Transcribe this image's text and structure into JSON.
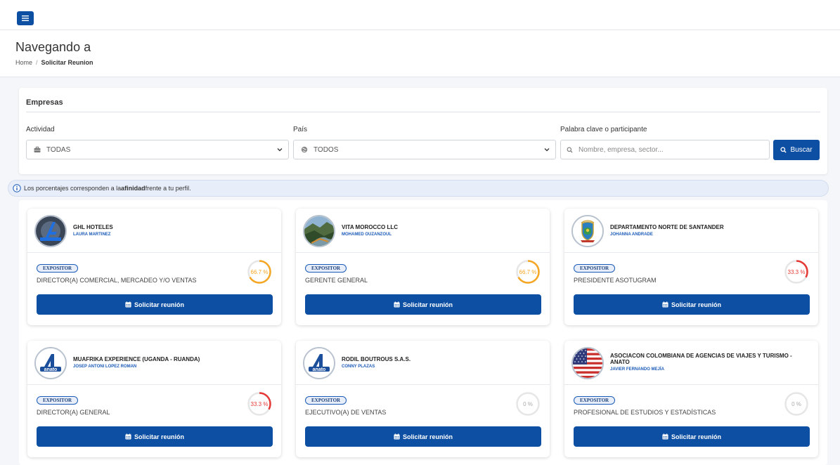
{
  "page": {
    "title": "Navegando a",
    "breadcrumb": {
      "home": "Home",
      "separator": "/",
      "current": "Solicitar Reunion"
    }
  },
  "filters": {
    "title": "Empresas",
    "actividad": {
      "label": "Actividad",
      "value": "TODAS"
    },
    "pais": {
      "label": "País",
      "value": "TODOS"
    },
    "keyword": {
      "label": "Palabra clave o participante",
      "placeholder": "Nombre, empresa, sector..."
    },
    "search_label": "Buscar"
  },
  "info": {
    "before": "Los porcentajes corresponden a la ",
    "bold": "afinidad",
    "after": " frente a tu perfil."
  },
  "colors": {
    "primary": "#0d4fa3",
    "accent_blue": "#1b5bb8",
    "orange": "#f5a623",
    "red": "#e53935",
    "grey_ring": "#dddddd"
  },
  "cards": [
    {
      "company": "GHL HOTELES",
      "contact": "LAURA MARTINEZ",
      "badge": "EXPOSITOR",
      "role": "DIRECTOR(A) COMERCIAL, MERCADEO Y/O VENTAS",
      "affinity": 66.7,
      "affinity_label": "66.7 %",
      "logo": "ghl-logo",
      "button": "Solicitar reunión"
    },
    {
      "company": "VITA MOROCCO LLC",
      "contact": "MOHAMED OUZANZOUL",
      "badge": "EXPOSITOR",
      "role": "GERENTE GENERAL",
      "affinity": 66.7,
      "affinity_label": "66.7 %",
      "logo": "landscape-photo",
      "button": "Solicitar reunión"
    },
    {
      "company": "DEPARTAMENTO NORTE DE SANTANDER",
      "contact": "JOHANNA ANDRADE",
      "badge": "EXPOSITOR",
      "role": "PRESIDENTE ASOTUGRAM",
      "affinity": 33.3,
      "affinity_label": "33.3 %",
      "logo": "shield-emblem",
      "button": "Solicitar reunión"
    },
    {
      "company": "MUAFRIKA EXPERIENCE (UGANDA - RUANDA)",
      "contact": "JOSEP ANTONI LOPEZ ROMAN",
      "badge": "EXPOSITOR",
      "role": "DIRECTOR(A) GENERAL",
      "affinity": 33.3,
      "affinity_label": "33.3 %",
      "logo": "anato-logo",
      "button": "Solicitar reunión"
    },
    {
      "company": "RODIL BOUTROUS S.A.S.",
      "contact": "CONNY PLAZAS",
      "badge": "EXPOSITOR",
      "role": "EJECUTIVO(A) DE VENTAS",
      "affinity": 0,
      "affinity_label": "0 %",
      "logo": "anato-logo",
      "button": "Solicitar reunión"
    },
    {
      "company": "ASOCIACON COLOMBIANA DE AGENCIAS DE VIAJES Y TURISMO - ANATO",
      "contact": "JAVIER FERNANDO MEJÍA",
      "badge": "EXPOSITOR",
      "role": "PROFESIONAL DE ESTUDIOS Y ESTADÍSTICAS",
      "affinity": 0,
      "affinity_label": "0 %",
      "logo": "us-flag",
      "button": "Solicitar reunión"
    }
  ]
}
